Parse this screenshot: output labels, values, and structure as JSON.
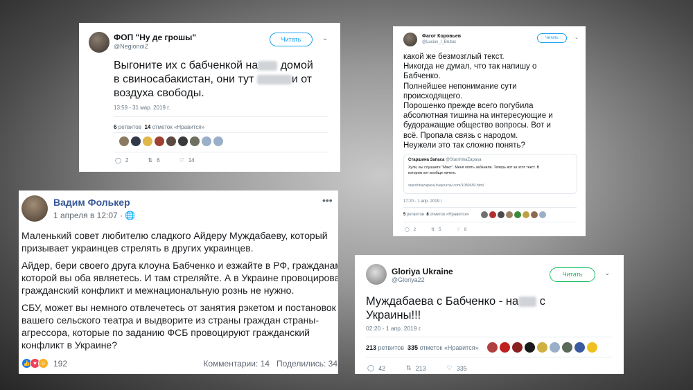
{
  "tweet1": {
    "name": "ФОП \"Ну де грошы\"",
    "handle": "@NegionoiZ",
    "follow_label": "Читать",
    "lines": [
      "Выгоните их с бабченкой на",
      "домой",
      "в свиносабакистан, они тут",
      "и от",
      "воздуха свободы."
    ],
    "timestamp": "13:59 - 31 мар. 2019 г.",
    "retweets_count": "6",
    "retweets_label": "ретвитов",
    "likes_count": "14",
    "likes_label": "отметок «Нравится»",
    "reply_count": "2",
    "retweet_action_count": "6",
    "like_action_count": "14",
    "face_colors": [
      "#8a7a60",
      "#30384a",
      "#e0b84a",
      "#a04030",
      "#5a4a40",
      "#3a3a3a",
      "#707060",
      "#9ab0c8",
      "#9ab0c8"
    ]
  },
  "tweet2": {
    "name": "Фагот Коровьев",
    "handle": "@Lucius_I_Brutus",
    "follow_label": "Читать",
    "lines": [
      "какой же безмозглый текст.",
      "Никогда не думал, что так напишу о",
      "Бабченко.",
      "Полнейшее непонимание сути",
      "происходящего.",
      "Порошенко прежде всего погубила",
      "абсолютная тишина на интересующие и",
      "будоражащие общество вопросы. Вот и",
      "всё. Пропала связь с народом.",
      "Неужели это так сложно понять?"
    ],
    "quote": {
      "name": "Старшина Запаса",
      "handle": "@StarshinaZapasa",
      "line1": "Хули, вы слушаете \"Макс\". Меня опять забанили. Теперь вот за этот текст. В",
      "line2": "котором нет вообще ничего.",
      "link": "starshinazapasa.livejournal.com/1080650.html"
    },
    "timestamp": "17:20 - 1 апр. 2019 г.",
    "retweets_count": "5",
    "retweets_label": "ретвитов",
    "likes_count": "8",
    "likes_label": "отметок «Нравится»",
    "reply_count": "2",
    "retweet_action_count": "5",
    "like_action_count": "8",
    "face_colors": [
      "#707070",
      "#b03030",
      "#4a4a4a",
      "#9a8060",
      "#3a8a3a",
      "#c0a040",
      "#8a6a50",
      "#9ab0c8"
    ]
  },
  "fb_post": {
    "name": "Вадим Фолькер",
    "date": "1 апреля в 12:07 · ",
    "date_icon": "globe-icon",
    "paragraph1": [
      "Маленький совет любителю сладкого Айдеру Муждабаеву, который",
      "призывает украинцев стрелять в других украинцев."
    ],
    "paragraph2": [
      "Айдер, бери своего друга клоуна Бабченко и езжайте в РФ, гражданами,",
      "которой вы оба являетесь. И там стреляйте. А в Украине провоцировать",
      "гражданский конфликт и межнациональную рознь не нужно."
    ],
    "paragraph3": [
      "СБУ, может вы немного отвлечетесь от занятия рэкетом и постановок",
      "вашего сельского театра и выдворите из страны граждан страны-",
      "агрессора, которые по заданию ФСБ провоцируют гражданский",
      "конфликт в Украине?"
    ],
    "reactions_count": "192",
    "comments": "Комментарии: 14",
    "shares": "Поделились: 34"
  },
  "tweet3": {
    "name": "Gloriya Ukraine",
    "handle": "@Gloriya22",
    "follow_label": "Читать",
    "line1a": "Муждабаева с Бабченко - на",
    "line1b": "с",
    "line2": "Украины!!!",
    "timestamp": "02:20 - 1 апр. 2019 г.",
    "retweets_count": "213",
    "retweets_label": "ретвитов",
    "likes_count": "335",
    "likes_label": "отметок «Нравится»",
    "reply_count": "42",
    "retweet_action_count": "213",
    "like_action_count": "335",
    "face_colors": [
      "#b04040",
      "#c02020",
      "#8a2020",
      "#1a1a1a",
      "#d0b040",
      "#9ab0c8",
      "#5a6a5a",
      "#3a5aa0",
      "#f0c020"
    ]
  },
  "colors": {
    "twitter_blue": "#1da1f2",
    "fb_blue": "#385898",
    "muted": "#657786"
  }
}
